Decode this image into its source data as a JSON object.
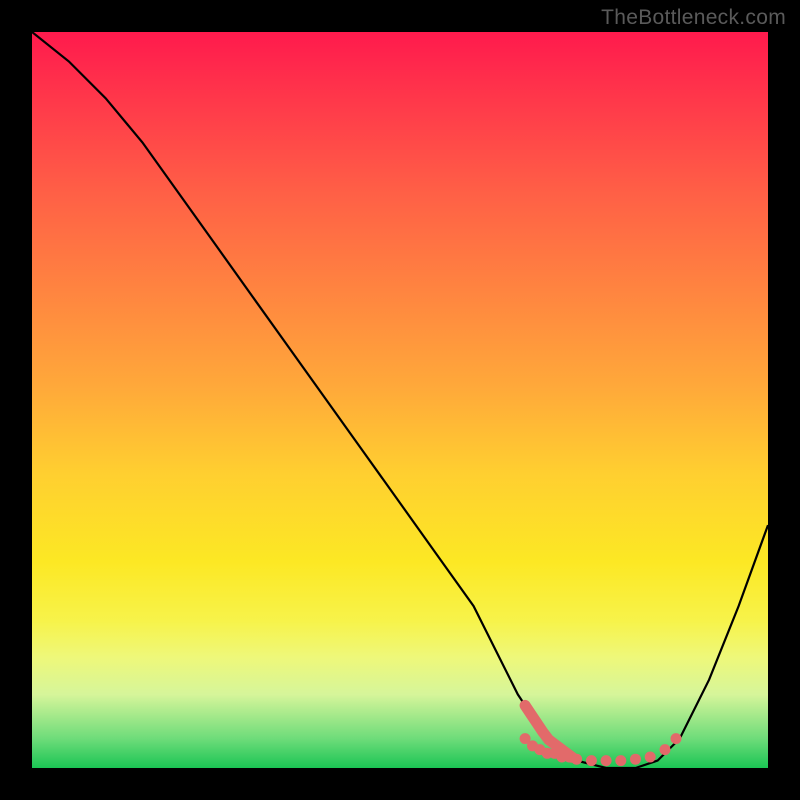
{
  "watermark": "TheBottleneck.com",
  "chart_data": {
    "type": "line",
    "title": "",
    "xlabel": "",
    "ylabel": "",
    "xlim": [
      0,
      100
    ],
    "ylim": [
      0,
      100
    ],
    "grid": false,
    "legend": false,
    "series": [
      {
        "name": "bottleneck-curve",
        "color": "#000000",
        "x": [
          0,
          5,
          10,
          15,
          20,
          25,
          30,
          35,
          40,
          45,
          50,
          55,
          60,
          63,
          66,
          70,
          74,
          78,
          82,
          85,
          88,
          92,
          96,
          100
        ],
        "y": [
          100,
          96,
          91,
          85,
          78,
          71,
          64,
          57,
          50,
          43,
          36,
          29,
          22,
          16,
          10,
          4,
          1,
          0,
          0,
          1,
          4,
          12,
          22,
          33
        ]
      }
    ],
    "highlight_points": {
      "name": "optimal-range-dots",
      "color": "#e26a6a",
      "thick_segment": {
        "x_range": [
          67,
          74
        ],
        "y": 2
      },
      "points": [
        {
          "x": 67,
          "y": 4
        },
        {
          "x": 68,
          "y": 3
        },
        {
          "x": 69,
          "y": 2.5
        },
        {
          "x": 70,
          "y": 2
        },
        {
          "x": 71,
          "y": 2
        },
        {
          "x": 72,
          "y": 1.5
        },
        {
          "x": 73,
          "y": 1.5
        },
        {
          "x": 74,
          "y": 1.2
        },
        {
          "x": 76,
          "y": 1
        },
        {
          "x": 78,
          "y": 1
        },
        {
          "x": 80,
          "y": 1
        },
        {
          "x": 82,
          "y": 1.2
        },
        {
          "x": 84,
          "y": 1.5
        },
        {
          "x": 86,
          "y": 2.5
        },
        {
          "x": 87.5,
          "y": 4
        }
      ]
    },
    "gradient_stops": [
      {
        "pos": 0,
        "color": "#ff1a4d"
      },
      {
        "pos": 50,
        "color": "#ffcf30"
      },
      {
        "pos": 82,
        "color": "#f7f34a"
      },
      {
        "pos": 100,
        "color": "#1bc554"
      }
    ]
  }
}
